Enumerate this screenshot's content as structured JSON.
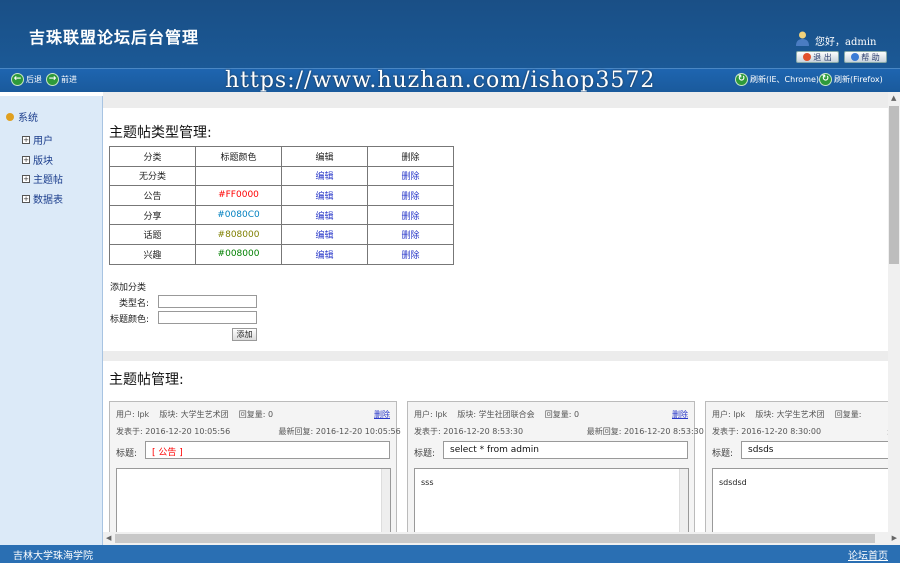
{
  "header": {
    "title": "吉珠联盟论坛后台管理",
    "greeting": "您好，admin",
    "logout_label": "退 出",
    "help_label": "帮 助"
  },
  "nav": {
    "back_label": "后退",
    "forward_label": "前进",
    "refresh_ie_label": "刷新(IE、Chrome)",
    "refresh_ff_label": "刷新(Firefox)",
    "watermark": "https://www.huzhan.com/ishop3572"
  },
  "sidebar": {
    "root_label": "系统",
    "items": [
      {
        "label": "用户"
      },
      {
        "label": "版块"
      },
      {
        "label": "主题帖"
      },
      {
        "label": "数据表"
      }
    ]
  },
  "type_section": {
    "title": "主题帖类型管理:",
    "headers": [
      "分类",
      "标题颜色",
      "编辑",
      "删除"
    ],
    "rows": [
      {
        "category": "无分类",
        "color": "",
        "edit": "编辑",
        "delete": "删除"
      },
      {
        "category": "公告",
        "color": "#FF0000",
        "edit": "编辑",
        "delete": "删除"
      },
      {
        "category": "分享",
        "color": "#0080C0",
        "edit": "编辑",
        "delete": "删除"
      },
      {
        "category": "话题",
        "color": "#808000",
        "edit": "编辑",
        "delete": "删除"
      },
      {
        "category": "兴趣",
        "color": "#008000",
        "edit": "编辑",
        "delete": "删除"
      }
    ],
    "add_title": "添加分类",
    "type_name_label": "类型名:",
    "title_color_label": "标题颜色:",
    "add_button": "添加"
  },
  "topic_section": {
    "title": "主题帖管理:",
    "cards": [
      {
        "meta_user": "用户: lpk",
        "meta_board": "版块: 大学生艺术团",
        "meta_replies": "回复量: 0",
        "delete": "删除",
        "posted": "发表于: 2016-12-20 10:05:56",
        "last_reply": "最新回复: 2016-12-20 10:05:56",
        "title_label": "标题:",
        "title_value": "[ 公告 ]",
        "title_color": "#FF0000",
        "body": ""
      },
      {
        "meta_user": "用户: lpk",
        "meta_board": "版块: 学生社团联合会",
        "meta_replies": "回复量: 0",
        "delete": "删除",
        "posted": "发表于: 2016-12-20 8:53:30",
        "last_reply": "最新回复: 2016-12-20 8:53:30",
        "title_label": "标题:",
        "title_value": "select * from admin",
        "title_color": "#111111",
        "body": "sss"
      },
      {
        "meta_user": "用户: lpk",
        "meta_board": "版块: 大学生艺术团",
        "meta_replies": "回复量:",
        "delete": "",
        "posted": "发表于: 2016-12-20 8:30:00",
        "last_reply": "最新",
        "title_label": "标题:",
        "title_value": "sdsds",
        "title_color": "#111111",
        "body": "sdsdsd"
      }
    ]
  },
  "footer": {
    "left": "吉林大学珠海学院",
    "right": "论坛首页"
  }
}
